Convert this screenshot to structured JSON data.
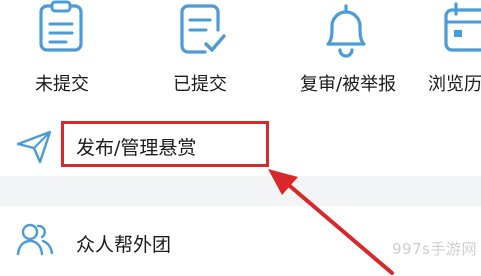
{
  "icon_bar": {
    "items": [
      {
        "icon": "clipboard-list-icon",
        "label": "未提交"
      },
      {
        "icon": "clipboard-check-icon",
        "label": "已提交"
      },
      {
        "icon": "bell-icon",
        "label": "复审/被举报"
      },
      {
        "icon": "calendar-icon",
        "label": "浏览历"
      }
    ],
    "icon_color": "#4a9bd8"
  },
  "menu": {
    "publish_label": "发布/管理悬赏",
    "group_label": "众人帮外团"
  },
  "annotation": {
    "highlight_color": "#d9282a"
  },
  "watermark": "997s手游网"
}
